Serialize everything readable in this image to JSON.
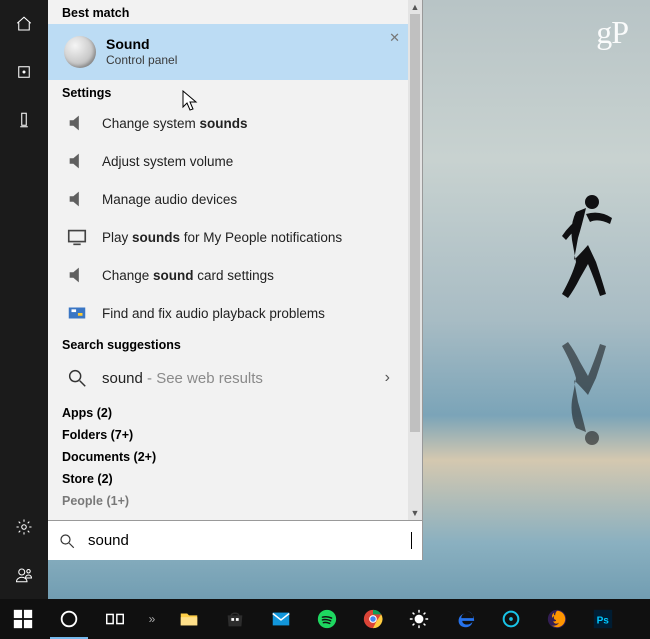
{
  "watermark": "gP",
  "headers": {
    "best": "Best match",
    "settings": "Settings",
    "suggestions": "Search suggestions"
  },
  "best_match": {
    "title": "Sound",
    "subtitle": "Control panel"
  },
  "settings_items": {
    "i0_pre": "Change system ",
    "i0_b": "sounds",
    "i0_post": "",
    "i1": "Adjust system volume",
    "i2": "Manage audio devices",
    "i3_pre": "Play ",
    "i3_b": "sounds",
    "i3_post": " for My People notifications",
    "i4_pre": "Change ",
    "i4_b": "sound",
    "i4_post": " card settings",
    "i5": "Find and fix audio playback problems"
  },
  "suggestion": {
    "term": "sound",
    "hint": " - See web results"
  },
  "categories": {
    "apps": "Apps (2)",
    "folders": "Folders (7+)",
    "documents": "Documents (2+)",
    "store": "Store (2)",
    "people": "People (1+)"
  },
  "search": {
    "value": "sound"
  }
}
